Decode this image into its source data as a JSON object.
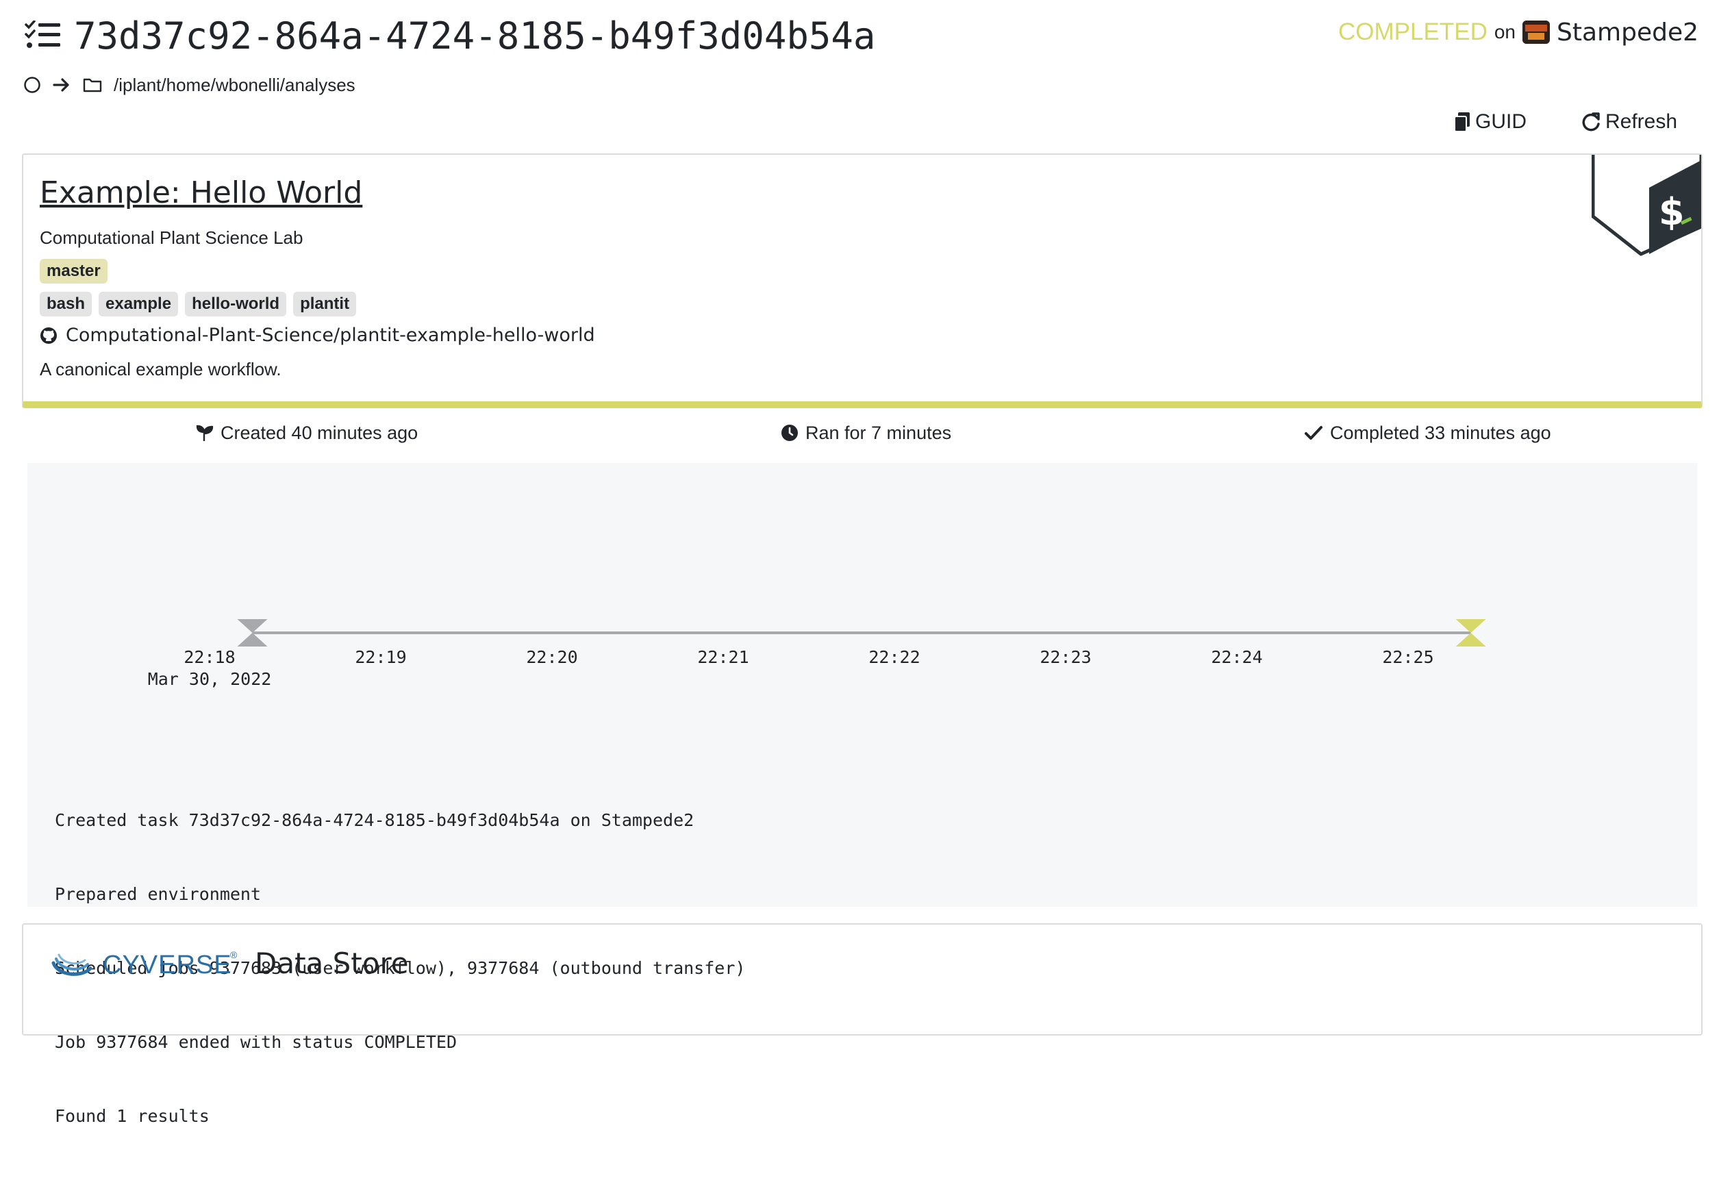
{
  "task": {
    "id": "73d37c92-864a-4724-8185-b49f3d04b54a",
    "status": "COMPLETED",
    "on_label": "on",
    "agent": "Stampede2",
    "path": "/iplant/home/wbonelli/analyses"
  },
  "actions": {
    "guid_label": "GUID",
    "refresh_label": "Refresh"
  },
  "workflow": {
    "name": "Example: Hello World",
    "author": "Computational Plant Science Lab",
    "branch": "master",
    "tags": [
      "bash",
      "example",
      "hello-world",
      "plantit"
    ],
    "repo": "Computational-Plant-Science/plantit-example-hello-world",
    "description": "A canonical example workflow."
  },
  "stats": {
    "created": "Created 40 minutes ago",
    "ran": "Ran for 7 minutes",
    "completed": "Completed 33 minutes ago"
  },
  "timeline": {
    "ticks": [
      "22:18",
      "22:19",
      "22:20",
      "22:21",
      "22:22",
      "22:23",
      "22:24",
      "22:25"
    ],
    "date_label": "Mar 30, 2022",
    "start": "22:18:15",
    "end": "22:25:22"
  },
  "log": [
    "Created task 73d37c92-864a-4724-8185-b49f3d04b54a on Stampede2",
    "Prepared environment",
    "Scheduled jobs 9377683 (user workflow), 9377684 (outbound transfer)",
    "Job 9377684 ended with status COMPLETED",
    "Found 1 results"
  ],
  "datastore": {
    "brand": "CYVERSE",
    "trademark": "®",
    "title": "Data Store"
  },
  "colors": {
    "accent": "#d6d96a",
    "text": "#212529",
    "muted": "#a7a9ac",
    "panel": "#f6f7f9",
    "brand_blue": "#2a6fa6"
  }
}
